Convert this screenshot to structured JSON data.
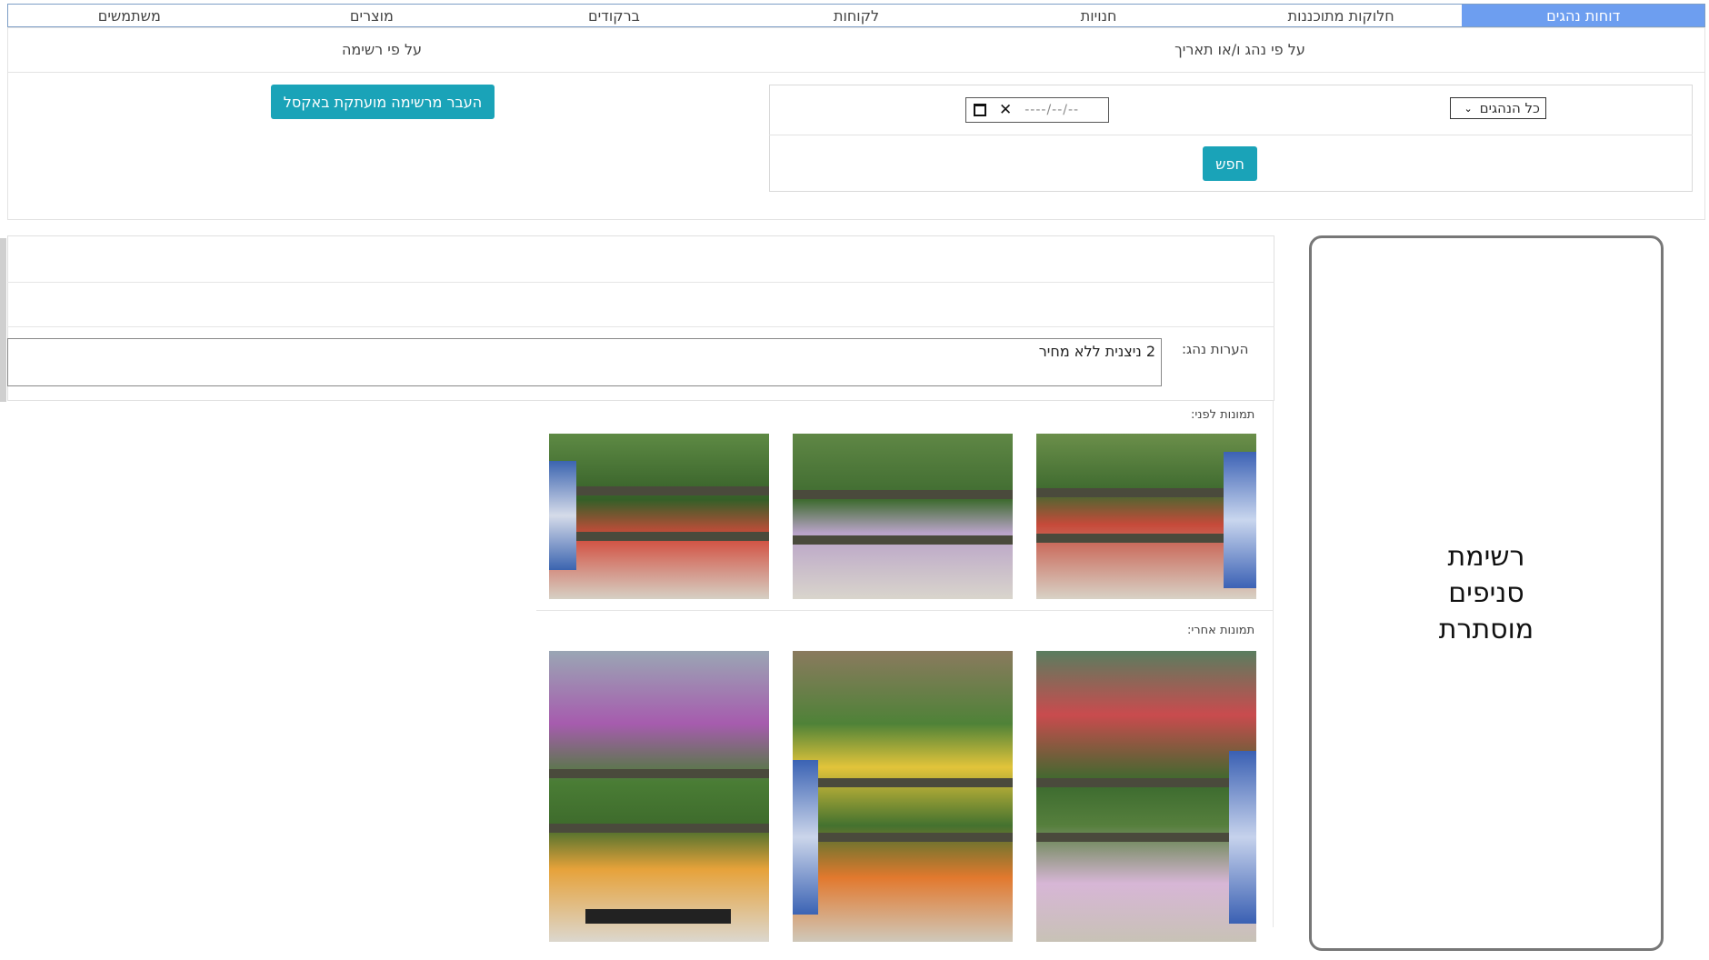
{
  "nav": {
    "tabs": [
      {
        "label": "דוחות נהגים",
        "active": true
      },
      {
        "label": "חלוקות מתוכננות",
        "active": false
      },
      {
        "label": "חנויות",
        "active": false
      },
      {
        "label": "לקוחות",
        "active": false
      },
      {
        "label": "ברקודים",
        "active": false
      },
      {
        "label": "מוצרים",
        "active": false
      },
      {
        "label": "משתמשים",
        "active": false
      }
    ]
  },
  "filters": {
    "by_driver_date_label": "על פי נהג ו/או תאריך",
    "by_list_label": "על פי רשימה",
    "driver_select": {
      "value": "כל הנהגים"
    },
    "date_input": {
      "placeholder": "----/--/--"
    },
    "search_button": "חפש",
    "export_button": "העבר מרשימה מועתקת באקסל"
  },
  "branches_panel": {
    "text": "רשימת סניפים מוסתרת"
  },
  "report": {
    "notes_label": "הערות נהג:",
    "notes_value": "2 ניצנית ללא מחיר",
    "before_label": "תמונות לפני:",
    "after_label": "תמונות אחרי:"
  },
  "colors": {
    "active_tab": "#6d9ef0",
    "button": "#1aa3b8"
  }
}
